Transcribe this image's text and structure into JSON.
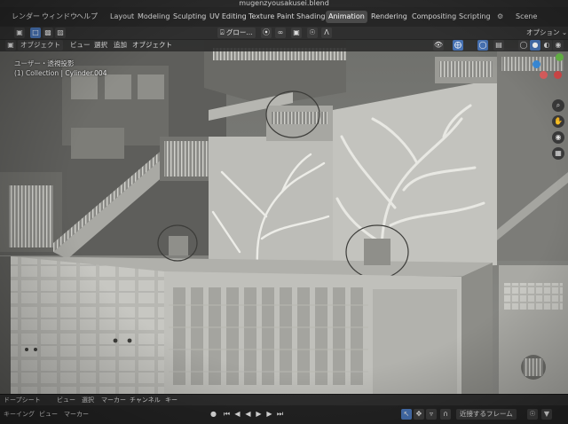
{
  "window": {
    "file_title": "mugenzyousakusei.blend"
  },
  "topbar": {
    "menus": [
      "レンダー",
      "ウィンドウ",
      "ヘルプ"
    ],
    "workspaces": [
      "Layout",
      "Modeling",
      "Sculpting",
      "UV Editing",
      "Texture Paint",
      "Shading",
      "Animation",
      "Rendering",
      "Compositing",
      "Scripting"
    ],
    "active_workspace": "Animation",
    "scene_label": "Scene"
  },
  "viewport_header": {
    "mode_label": "オブジェクト",
    "menus": [
      "ビュー",
      "選択",
      "追加",
      "オブジェクト"
    ],
    "transform_label": "グロー..."
  },
  "viewport": {
    "view_name": "ユーザー・透視投影",
    "collection_info": "(1) Collection | Cylinder.004"
  },
  "timeline_header": {
    "mode_label": "ドープシート",
    "menus": [
      "ビュー",
      "選択",
      "マーカー",
      "チャンネル",
      "キー"
    ]
  },
  "bottom_bar": {
    "mode_label": "キーイング",
    "menus": [
      "ビュー",
      "マーカー"
    ],
    "snap_label": "近接するフレーム"
  },
  "colors": {
    "accent": "#4772b3",
    "active_tab": "#4b4b4b",
    "viewport_bg": "#8a8a86"
  }
}
